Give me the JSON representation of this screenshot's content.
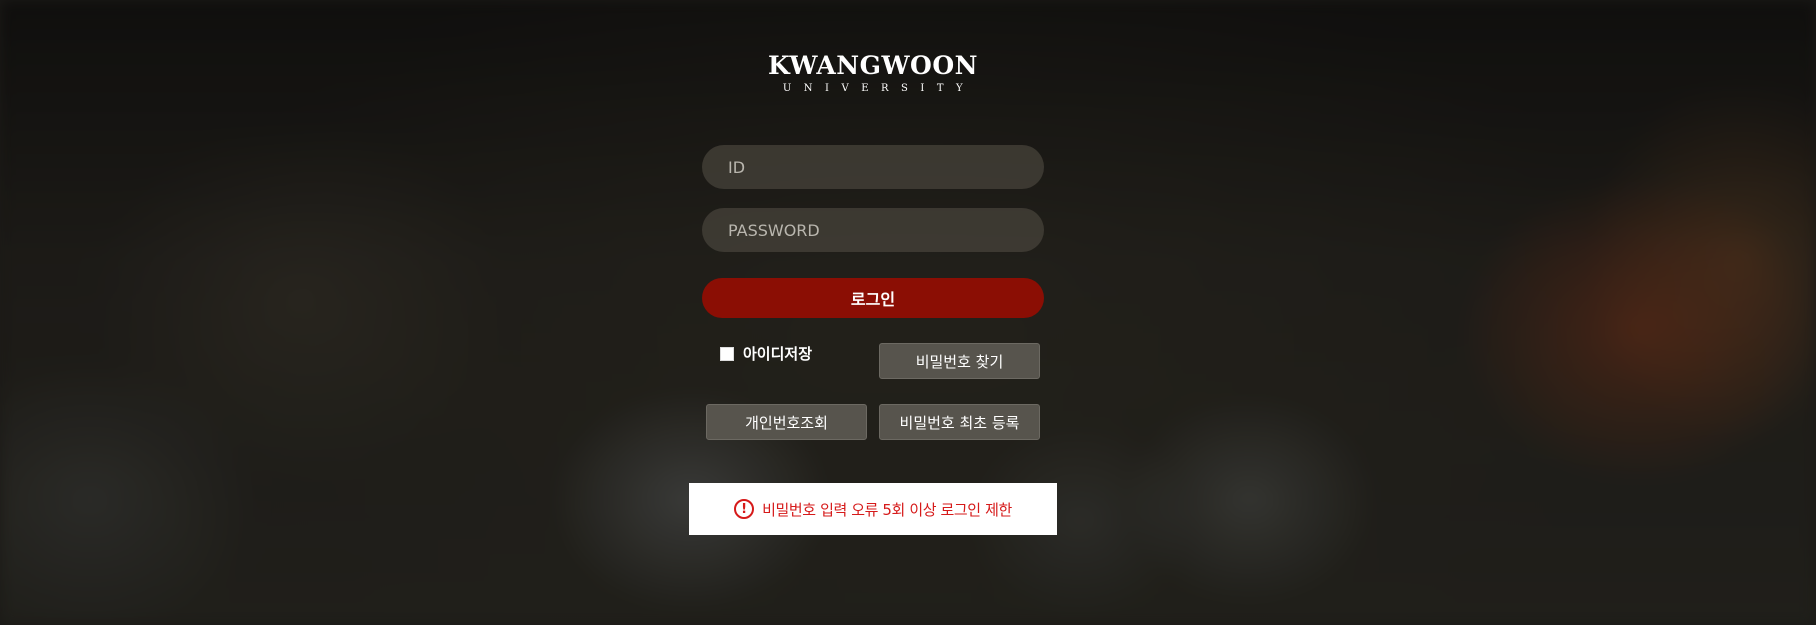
{
  "logo": {
    "main": "KWANGWOON",
    "sub": "UNIVERSITY"
  },
  "form": {
    "id_placeholder": "ID",
    "password_placeholder": "PASSWORD",
    "login_label": "로그인"
  },
  "options": {
    "remember_id_label": "아이디저장",
    "remember_id_checked": false,
    "find_password_label": "비밀번호 찾기",
    "personal_number_lookup_label": "개인번호조회",
    "initial_password_register_label": "비밀번호 최초 등록"
  },
  "notice": {
    "icon": "exclamation-circle-icon",
    "icon_glyph": "!",
    "text": "비밀번호 입력 오류 5회 이상 로그인 제한"
  },
  "colors": {
    "login_button": "#8b0e04",
    "notice_text": "#d61a1a",
    "secondary_button": "#57544d"
  }
}
